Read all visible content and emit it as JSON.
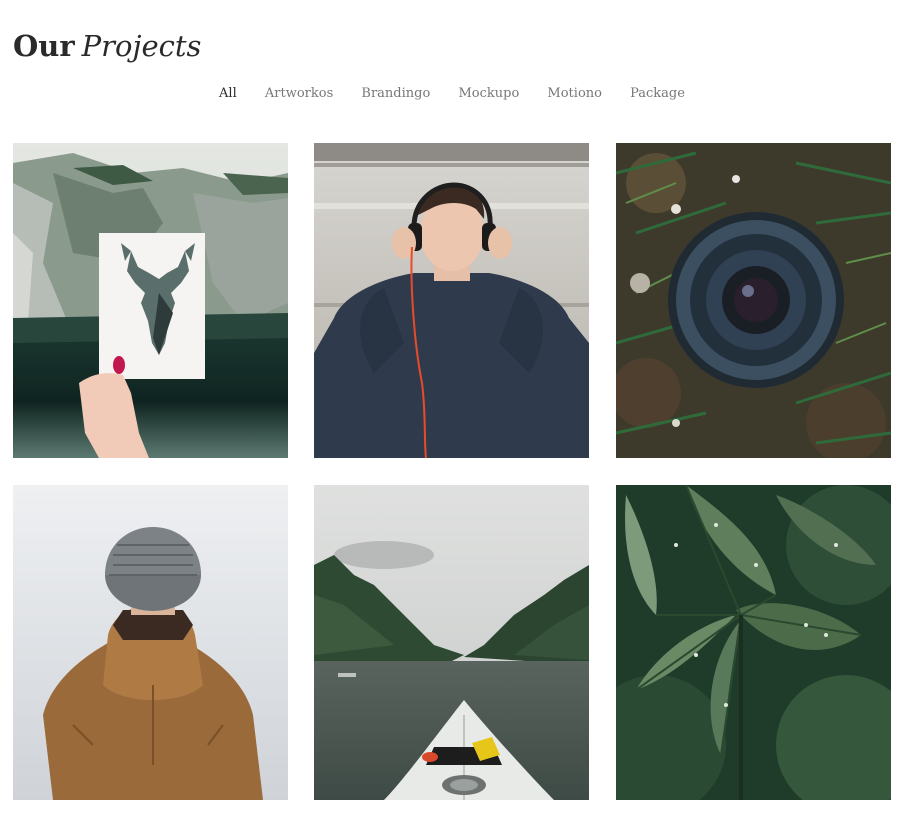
{
  "header": {
    "title_bold": "Our",
    "title_italic": "Projects"
  },
  "filters": [
    {
      "label": "All",
      "active": true
    },
    {
      "label": "Artworkos",
      "active": false
    },
    {
      "label": "Brandingo",
      "active": false
    },
    {
      "label": "Mockupo",
      "active": false
    },
    {
      "label": "Motiono",
      "active": false
    },
    {
      "label": "Package",
      "active": false
    }
  ],
  "projects": [
    {
      "image": "deer-card-photo",
      "tone": "#4b6b63"
    },
    {
      "image": "headphones-man-photo",
      "tone": "#2f3b4d"
    },
    {
      "image": "camera-lens-photo",
      "tone": "#3d3a2c"
    },
    {
      "image": "beanie-jacket-photo",
      "tone": "#9b6a3a"
    },
    {
      "image": "kayak-lake-photo",
      "tone": "#4d5a4a"
    },
    {
      "image": "wet-leaves-photo",
      "tone": "#2d4a36"
    }
  ]
}
